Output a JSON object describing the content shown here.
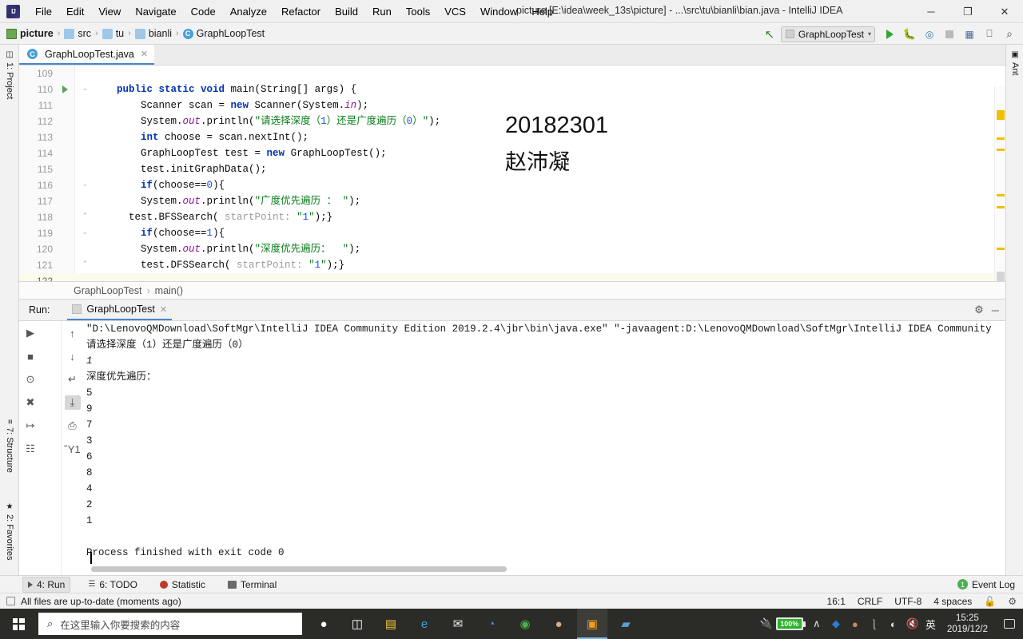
{
  "titlebar": {
    "window_title": "picture [E:\\idea\\week_13s\\picture] - ...\\src\\tu\\bianli\\bian.java - IntelliJ IDEA",
    "minimize": "─",
    "maximize": "❐",
    "close": "✕",
    "menu": [
      {
        "label": "File"
      },
      {
        "label": "Edit"
      },
      {
        "label": "View"
      },
      {
        "label": "Navigate"
      },
      {
        "label": "Code"
      },
      {
        "label": "Analyze"
      },
      {
        "label": "Refactor"
      },
      {
        "label": "Build"
      },
      {
        "label": "Run"
      },
      {
        "label": "Tools"
      },
      {
        "label": "VCS"
      },
      {
        "label": "Window"
      },
      {
        "label": "Help"
      }
    ]
  },
  "navbar": {
    "breadcrumb": [
      {
        "label": "picture",
        "icon": "project-icon"
      },
      {
        "label": "src",
        "icon": "folder-icon"
      },
      {
        "label": "tu",
        "icon": "folder-icon"
      },
      {
        "label": "bianli",
        "icon": "folder-icon"
      },
      {
        "label": "GraphLoopTest",
        "icon": "class-icon"
      }
    ],
    "separator": "›",
    "run_config": "GraphLoopTest",
    "run_config_chevron": "▾"
  },
  "left_strip": {
    "project": "1: Project",
    "structure": "7: Structure",
    "favorites": "2: Favorites"
  },
  "right_strip": {
    "ant": "Ant"
  },
  "editor": {
    "tab_label": "GraphLoopTest.java",
    "tab_close": "✕",
    "watermark_id": "20182301",
    "watermark_name": "赵沛凝",
    "breadcrumb_class": "GraphLoopTest",
    "breadcrumb_method": "main()",
    "breadcrumb_sep": "›",
    "lines": [
      {
        "num": "109",
        "partial": true,
        "segments": []
      },
      {
        "num": "110",
        "runmark": true,
        "fold": "⌄",
        "segments": [
          {
            "t": "    ",
            "c": ""
          },
          {
            "t": "public static void",
            "c": "kw"
          },
          {
            "t": " main(String[] args) {",
            "c": ""
          }
        ]
      },
      {
        "num": "111",
        "segments": [
          {
            "t": "        Scanner scan = ",
            "c": ""
          },
          {
            "t": "new",
            "c": "kw"
          },
          {
            "t": " Scanner(System.",
            "c": ""
          },
          {
            "t": "in",
            "c": "fld"
          },
          {
            "t": ");",
            "c": ""
          }
        ]
      },
      {
        "num": "112",
        "segments": [
          {
            "t": "        System.",
            "c": ""
          },
          {
            "t": "out",
            "c": "fld"
          },
          {
            "t": ".println(",
            "c": ""
          },
          {
            "t": "\"请选择深度（",
            "c": "str"
          },
          {
            "t": "1",
            "c": "num"
          },
          {
            "t": "）还是广度遍历（",
            "c": "str"
          },
          {
            "t": "0",
            "c": "num"
          },
          {
            "t": "）\"",
            "c": "str"
          },
          {
            "t": ");",
            "c": ""
          }
        ]
      },
      {
        "num": "113",
        "segments": [
          {
            "t": "        ",
            "c": ""
          },
          {
            "t": "int",
            "c": "kw"
          },
          {
            "t": " choose = scan.nextInt();",
            "c": ""
          }
        ]
      },
      {
        "num": "114",
        "segments": [
          {
            "t": "        GraphLoopTest test = ",
            "c": ""
          },
          {
            "t": "new",
            "c": "kw"
          },
          {
            "t": " GraphLoopTest();",
            "c": ""
          }
        ]
      },
      {
        "num": "115",
        "segments": [
          {
            "t": "        test.initGraphData();",
            "c": ""
          }
        ]
      },
      {
        "num": "116",
        "fold": "⌄",
        "segments": [
          {
            "t": "        ",
            "c": ""
          },
          {
            "t": "if",
            "c": "kw"
          },
          {
            "t": "(choose==",
            "c": ""
          },
          {
            "t": "0",
            "c": "num"
          },
          {
            "t": "){",
            "c": ""
          }
        ]
      },
      {
        "num": "117",
        "segments": [
          {
            "t": "        System.",
            "c": ""
          },
          {
            "t": "out",
            "c": "fld"
          },
          {
            "t": ".println(",
            "c": ""
          },
          {
            "t": "\"广度优先遍历 ： \"",
            "c": "str"
          },
          {
            "t": ");",
            "c": ""
          }
        ]
      },
      {
        "num": "118",
        "fold": "⌃",
        "segments": [
          {
            "t": "      test.BFSSearch( ",
            "c": ""
          },
          {
            "t": "startPoint:",
            "c": "hint"
          },
          {
            "t": " ",
            "c": ""
          },
          {
            "t": "\"",
            "c": "str"
          },
          {
            "t": "1",
            "c": "num"
          },
          {
            "t": "\"",
            "c": "str"
          },
          {
            "t": ");}",
            "c": ""
          }
        ]
      },
      {
        "num": "119",
        "fold": "⌄",
        "segments": [
          {
            "t": "        ",
            "c": ""
          },
          {
            "t": "if",
            "c": "kw"
          },
          {
            "t": "(choose==",
            "c": ""
          },
          {
            "t": "1",
            "c": "num"
          },
          {
            "t": "){",
            "c": ""
          }
        ]
      },
      {
        "num": "120",
        "segments": [
          {
            "t": "        System.",
            "c": ""
          },
          {
            "t": "out",
            "c": "fld"
          },
          {
            "t": ".println(",
            "c": ""
          },
          {
            "t": "\"深度优先遍历：  \"",
            "c": "str"
          },
          {
            "t": ");",
            "c": ""
          }
        ]
      },
      {
        "num": "121",
        "fold": "⌃",
        "segments": [
          {
            "t": "        test.DFSSearch( ",
            "c": ""
          },
          {
            "t": "startPoint:",
            "c": "hint"
          },
          {
            "t": " ",
            "c": ""
          },
          {
            "t": "\"",
            "c": "str"
          },
          {
            "t": "1",
            "c": "num"
          },
          {
            "t": "\"",
            "c": "str"
          },
          {
            "t": ");}",
            "c": ""
          }
        ]
      },
      {
        "num": "122",
        "current": true,
        "segments": []
      }
    ]
  },
  "run_panel": {
    "label": "Run:",
    "tab_label": "GraphLoopTest",
    "tab_close": "✕",
    "settings_icon": "⚙",
    "minimize_icon": "─",
    "console_lines": [
      {
        "text": "\"D:\\LenovoQMDownload\\SoftMgr\\IntelliJ IDEA Community Edition 2019.2.4\\jbr\\bin\\java.exe\" \"-javaagent:D:\\LenovoQMDownload\\SoftMgr\\IntelliJ IDEA Community Edition 2019.2.",
        "kind": "cmd"
      },
      {
        "text": "请选择深度（1）还是广度遍历（0）",
        "kind": "sysout"
      },
      {
        "text": "1",
        "kind": "inp"
      },
      {
        "text": "深度优先遍历：",
        "kind": "sysout"
      },
      {
        "text": "5",
        "kind": "sysout"
      },
      {
        "text": "9",
        "kind": "sysout"
      },
      {
        "text": "7",
        "kind": "sysout"
      },
      {
        "text": "3",
        "kind": "sysout"
      },
      {
        "text": "6",
        "kind": "sysout"
      },
      {
        "text": "8",
        "kind": "sysout"
      },
      {
        "text": "4",
        "kind": "sysout"
      },
      {
        "text": "2",
        "kind": "sysout"
      },
      {
        "text": "1",
        "kind": "sysout"
      },
      {
        "text": "",
        "kind": "sysout"
      },
      {
        "text": "Process finished with exit code 0",
        "kind": "sysout"
      }
    ],
    "toolbar_left": [
      {
        "icon": "▶",
        "name": "rerun-icon"
      },
      {
        "icon": "■",
        "name": "stop-icon"
      },
      {
        "icon": "⊙",
        "name": "camera-icon"
      },
      {
        "icon": "✖",
        "name": "coverage-icon"
      },
      {
        "icon": "↦",
        "name": "export-icon"
      },
      {
        "icon": "☷",
        "name": "dump-icon"
      }
    ],
    "toolbar_right": [
      {
        "icon": "↑",
        "name": "up-arrow-icon"
      },
      {
        "icon": "↓",
        "name": "down-arrow-icon"
      },
      {
        "icon": "↵",
        "name": "soft-wrap-icon"
      },
      {
        "icon": "⤓",
        "name": "scroll-to-end-icon",
        "selected": true
      },
      {
        "icon": "⎙",
        "name": "print-icon"
      },
      {
        "icon": "Ὕ1",
        "name": "trash-icon"
      }
    ]
  },
  "bottom_tabs": {
    "run": "4: Run",
    "todo": "6: TODO",
    "statistic": "Statistic",
    "terminal": "Terminal",
    "event_log": "Event Log",
    "event_log_count": "1"
  },
  "statusbar": {
    "message": "All files are up-to-date (moments ago)",
    "position": "16:1",
    "line_sep": "CRLF",
    "encoding": "UTF-8",
    "indent": "4 spaces",
    "lock_icon": "ὑ3",
    "inspect_icon": "⚙"
  },
  "taskbar": {
    "search_placeholder": "在这里输入你要搜索的内容",
    "search_icon": "⌕",
    "clock_time": "15:25",
    "clock_date": "2019/12/2",
    "battery_percent": "100%",
    "ime": "英",
    "items": [
      {
        "name": "cortana-icon",
        "glyph": "●",
        "color": "#ffffff"
      },
      {
        "name": "task-view-icon",
        "glyph": "◫",
        "color": "#ffffff"
      },
      {
        "name": "file-explorer-icon",
        "glyph": "▤",
        "color": "#f5c542"
      },
      {
        "name": "edge-icon",
        "glyph": "e",
        "color": "#3aa0e0"
      },
      {
        "name": "mail-icon",
        "glyph": "✉",
        "color": "#e8e8e8"
      },
      {
        "name": "clock-app-icon",
        "glyph": "◔",
        "color": "#4a90d9"
      },
      {
        "name": "wechat-icon",
        "glyph": "◉",
        "color": "#4caf50"
      },
      {
        "name": "browser-icon",
        "glyph": "●",
        "color": "#d0b090"
      },
      {
        "name": "idea-icon",
        "glyph": "▣",
        "color": "#f0a020",
        "running": true
      },
      {
        "name": "app-icon",
        "glyph": "▰",
        "color": "#5a9fd4"
      }
    ],
    "tray": [
      {
        "name": "show-hidden-icons",
        "glyph": "∧"
      },
      {
        "name": "dropbox-icon",
        "glyph": "◆",
        "color": "#2a7fd4"
      },
      {
        "name": "security-icon",
        "glyph": "●",
        "color": "#c98a5a"
      },
      {
        "name": "device-icon",
        "glyph": "⌨"
      },
      {
        "name": "wifi-icon",
        "glyph": "◠"
      },
      {
        "name": "volume-muted-icon",
        "glyph": "ὐ7"
      }
    ]
  }
}
